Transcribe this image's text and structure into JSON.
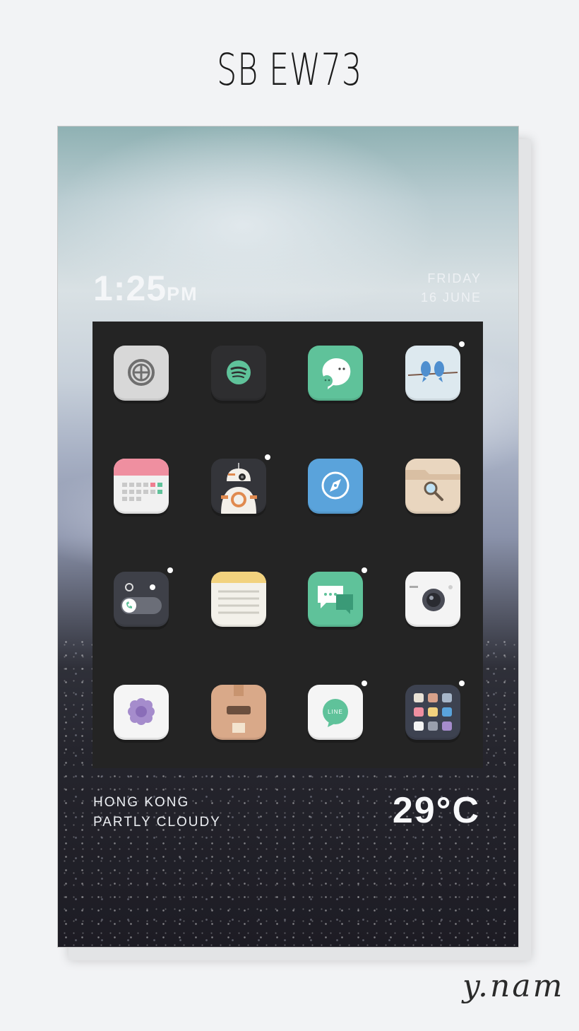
{
  "header": {
    "title": "SB EW73"
  },
  "lockscreen": {
    "time": "1:25",
    "ampm": "PM",
    "day": "FRIDAY",
    "date": "16 JUNE"
  },
  "apps": [
    {
      "name": "settings-icon",
      "bg": "#d8d8d8",
      "badge": false
    },
    {
      "name": "spotify-icon",
      "bg": "#2e2e30",
      "badge": false
    },
    {
      "name": "messenger-chat-icon",
      "bg": "#5fc29a",
      "badge": false
    },
    {
      "name": "twitter-birds-icon",
      "bg": "#dde9ef",
      "badge": true
    },
    {
      "name": "calendar-icon",
      "bg": "#f1f1f1",
      "badge": false
    },
    {
      "name": "bb8-droid-icon",
      "bg": "#34353a",
      "badge": true
    },
    {
      "name": "safari-compass-icon",
      "bg": "#5aa3db",
      "badge": false
    },
    {
      "name": "file-search-icon",
      "bg": "#e9d6bf",
      "badge": false
    },
    {
      "name": "alarm-phone-icon",
      "bg": "#3e4048",
      "badge": true
    },
    {
      "name": "notes-icon",
      "bg": "#f3f1ea",
      "badge": false
    },
    {
      "name": "message-bubbles-icon",
      "bg": "#5fc29a",
      "badge": true
    },
    {
      "name": "camera-icon",
      "bg": "#f4f4f4",
      "badge": false
    },
    {
      "name": "flower-icon",
      "bg": "#f5f5f5",
      "badge": false
    },
    {
      "name": "box-icon",
      "bg": "#d9a989",
      "badge": false
    },
    {
      "name": "line-icon",
      "bg": "#f5f5f5",
      "badge": true,
      "label": "LINE"
    },
    {
      "name": "app-grid-icon",
      "bg": "#3d4250",
      "badge": true
    }
  ],
  "weather": {
    "city": "HONG KONG",
    "condition": "PARTLY CLOUDY",
    "temperature": "29°C"
  },
  "signature": "y.nam"
}
